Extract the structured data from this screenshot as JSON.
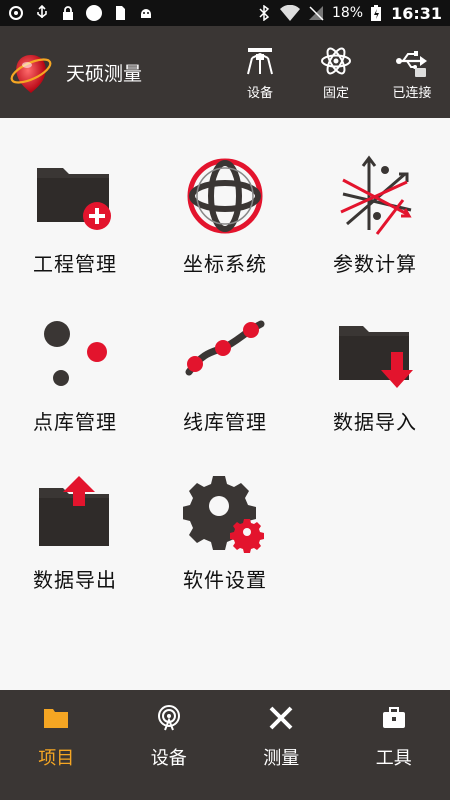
{
  "status_bar": {
    "battery": "18%",
    "time": "16:31"
  },
  "app_bar": {
    "title": "天硕测量",
    "actions": [
      {
        "label": "设备",
        "icon": "gnss-receiver-icon"
      },
      {
        "label": "固定",
        "icon": "atom-icon"
      },
      {
        "label": "已连接",
        "icon": "usb-icon"
      }
    ]
  },
  "tiles": [
    {
      "label": "工程管理",
      "icon": "folder-add-icon"
    },
    {
      "label": "坐标系统",
      "icon": "globe-icon"
    },
    {
      "label": "参数计算",
      "icon": "vector-arrows-icon"
    },
    {
      "label": "点库管理",
      "icon": "points-icon"
    },
    {
      "label": "线库管理",
      "icon": "polyline-icon"
    },
    {
      "label": "数据导入",
      "icon": "folder-import-icon"
    },
    {
      "label": "数据导出",
      "icon": "folder-export-icon"
    },
    {
      "label": "软件设置",
      "icon": "settings-gear-icon"
    }
  ],
  "bottom_nav": [
    {
      "label": "项目",
      "icon": "folder-icon",
      "active": true
    },
    {
      "label": "设备",
      "icon": "antenna-icon",
      "active": false
    },
    {
      "label": "测量",
      "icon": "measure-tools-icon",
      "active": false
    },
    {
      "label": "工具",
      "icon": "toolbox-icon",
      "active": false
    }
  ],
  "colors": {
    "bar_bg": "#3a3634",
    "accent_red": "#e3142d",
    "icon_dark": "#3a3634",
    "active_tab": "#f5a623"
  }
}
